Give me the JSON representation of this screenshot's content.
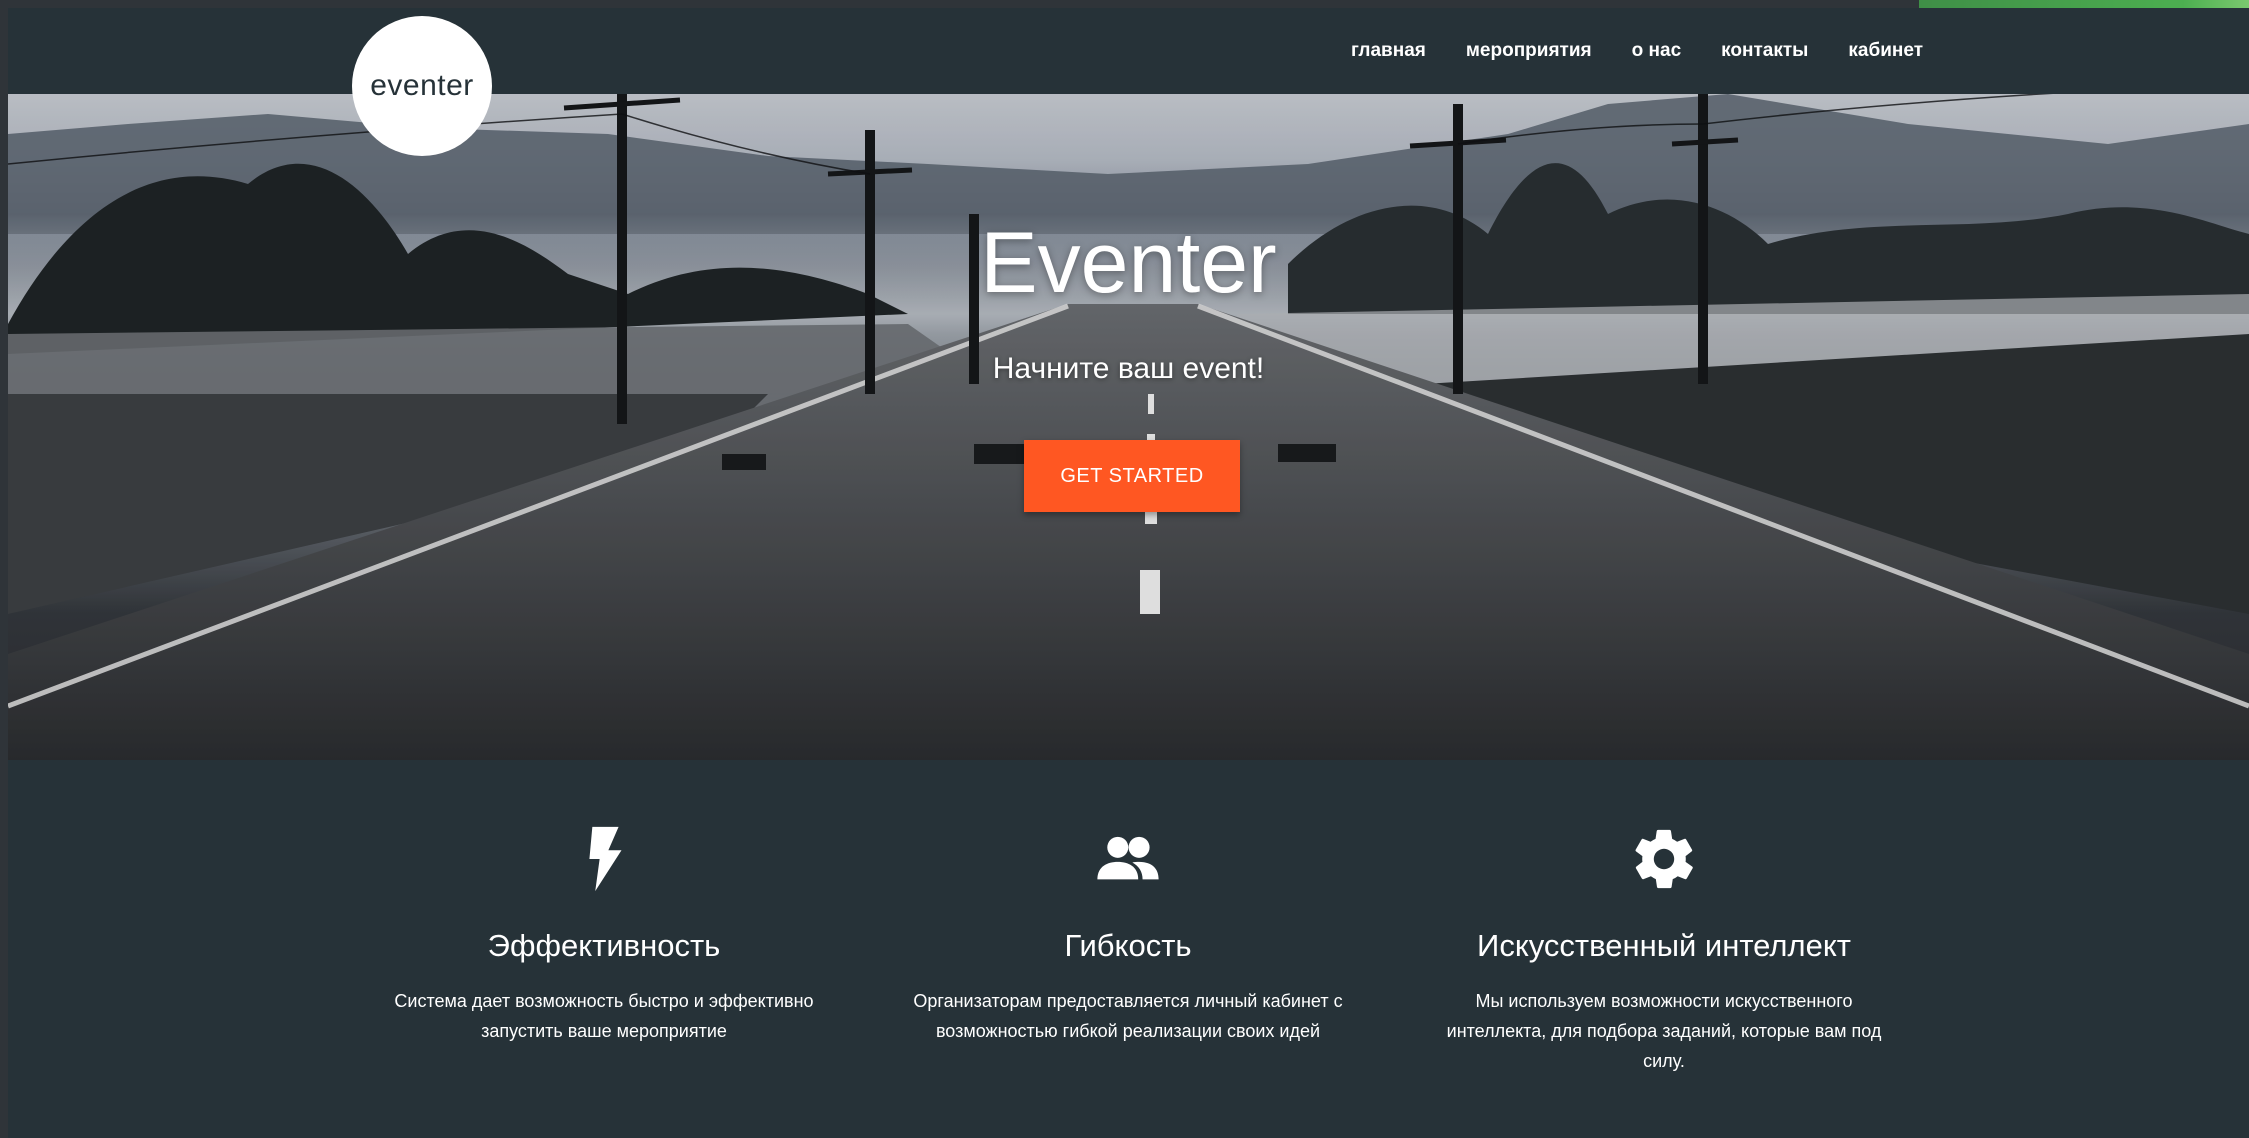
{
  "brand": {
    "logo_text": "eventer"
  },
  "nav": {
    "items": [
      {
        "label": "главная"
      },
      {
        "label": "мероприятия"
      },
      {
        "label": "о нас"
      },
      {
        "label": "контакты"
      },
      {
        "label": "кабинет"
      }
    ]
  },
  "hero": {
    "title": "Eventer",
    "subtitle": "Начните ваш event!",
    "cta_label": "GET STARTED"
  },
  "features": [
    {
      "icon": "lightning-icon",
      "title": "Эффективность",
      "text": "Система дает возможность быстро и эффективно запустить ваше мероприятие"
    },
    {
      "icon": "people-icon",
      "title": "Гибкость",
      "text": "Организаторам предоставляется личный кабинет с возможностью гибкой реализации своих идей"
    },
    {
      "icon": "gear-icon",
      "title": "Искусственный интеллект",
      "text": "Мы используем возможности искусственного интеллекта, для подбора заданий, которые вам под силу."
    }
  ],
  "colors": {
    "background": "#263238",
    "accent": "#ff5722",
    "text": "#ffffff"
  }
}
